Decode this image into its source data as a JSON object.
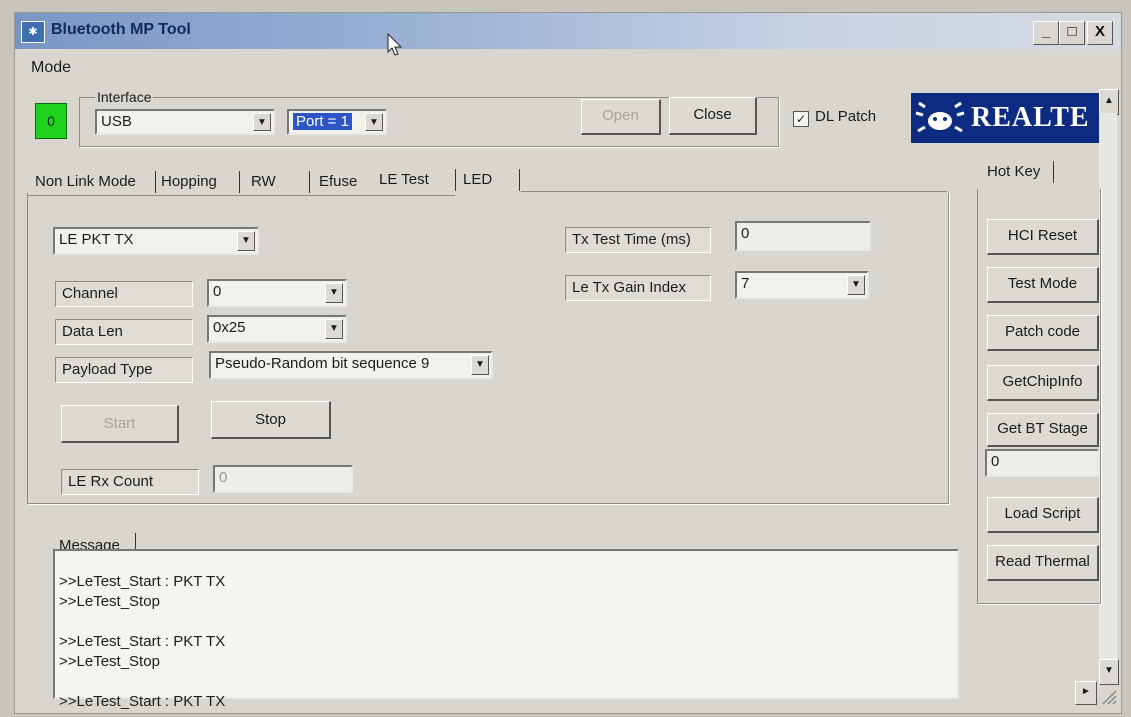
{
  "window": {
    "title": "Bluetooth MP Tool",
    "controls": [
      "_",
      "□",
      "X"
    ]
  },
  "menu": {
    "mode": "Mode"
  },
  "status_indicator": {
    "value": "0",
    "color": "#1fd31f"
  },
  "interface": {
    "group_label": "Interface",
    "selected": "USB",
    "port": "Port = 1",
    "open_label": "Open",
    "close_label": "Close",
    "dl_patch_label": "DL Patch",
    "dl_patch_checked": true
  },
  "logo": {
    "text": "REALTE"
  },
  "tabs": [
    {
      "label": "Non Link Mode"
    },
    {
      "label": "Hopping"
    },
    {
      "label": "RW"
    },
    {
      "label": "Efuse"
    },
    {
      "label": "LE Test",
      "active": true
    },
    {
      "label": "LED"
    }
  ],
  "le_test": {
    "mode_select": "LE PKT TX",
    "channel_label": "Channel",
    "channel_value": "0",
    "data_len_label": "Data Len",
    "data_len_value": "0x25",
    "payload_label": "Payload Type",
    "payload_value": "Pseudo-Random bit sequence 9",
    "start_label": "Start",
    "stop_label": "Stop",
    "rx_count_label": "LE Rx Count",
    "rx_count_value": "0",
    "tx_time_label": "Tx Test Time (ms)",
    "tx_time_value": "0",
    "gain_label": "Le Tx Gain Index",
    "gain_value": "7"
  },
  "hotkey": {
    "tab_label": "Hot Key",
    "hci_reset": "HCI Reset",
    "test_mode": "Test Mode",
    "patch_code": "Patch code",
    "get_chip_info": "GetChipInfo",
    "get_bt_stage": "Get BT Stage",
    "bt_stage_value": "0",
    "load_script": "Load Script",
    "read_thermal": "Read Thermal"
  },
  "message": {
    "tab_label": "Message",
    "lines": [
      ">>LeTest_Start : PKT TX",
      ">>LeTest_Stop",
      ">>LeTest_Start : PKT TX",
      ">>LeTest_Stop",
      ">>LeTest_Start : PKT TX"
    ]
  }
}
